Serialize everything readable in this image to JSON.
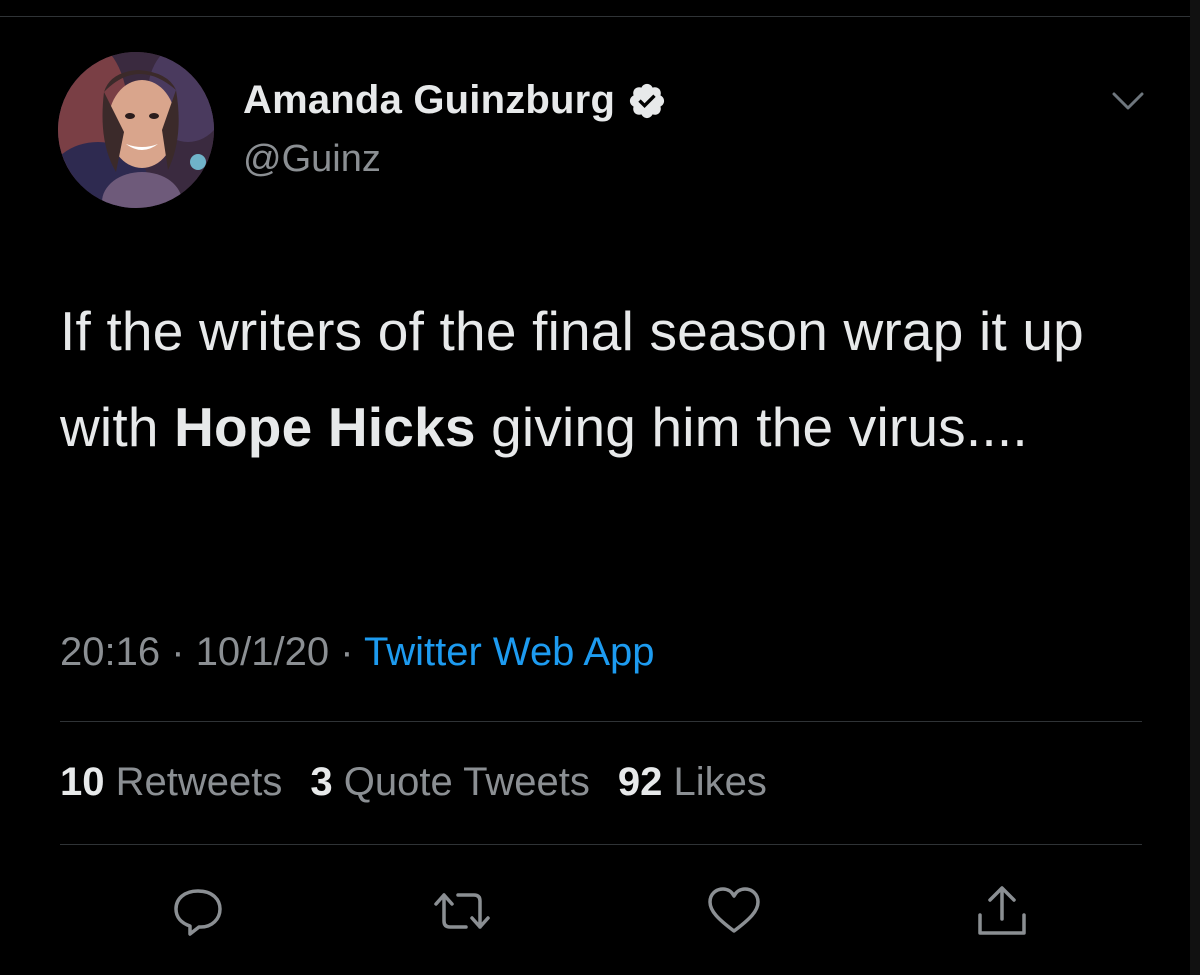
{
  "tweet": {
    "display_name": "Amanda Guinzburg",
    "handle": "@Guinz",
    "text_part1": "If the writers of the final season wrap it up with ",
    "text_bold": "Hope Hicks",
    "text_part2": " giving him the virus....",
    "time": "20:16",
    "date": "10/1/20",
    "separator": "·",
    "source": "Twitter Web App"
  },
  "stats": {
    "retweets_count": "10",
    "retweets_label": "Retweets",
    "quotes_count": "3",
    "quotes_label": "Quote Tweets",
    "likes_count": "92",
    "likes_label": "Likes"
  },
  "icons": {
    "verified": "verified-badge-icon",
    "menu": "chevron-down-icon",
    "reply": "reply-icon",
    "retweet": "retweet-icon",
    "like": "heart-icon",
    "share": "share-icon"
  },
  "colors": {
    "background": "#000000",
    "text": "#e7e9ea",
    "secondary_text": "#8b8f93",
    "link": "#1d9bf0",
    "divider": "#2f3336"
  }
}
